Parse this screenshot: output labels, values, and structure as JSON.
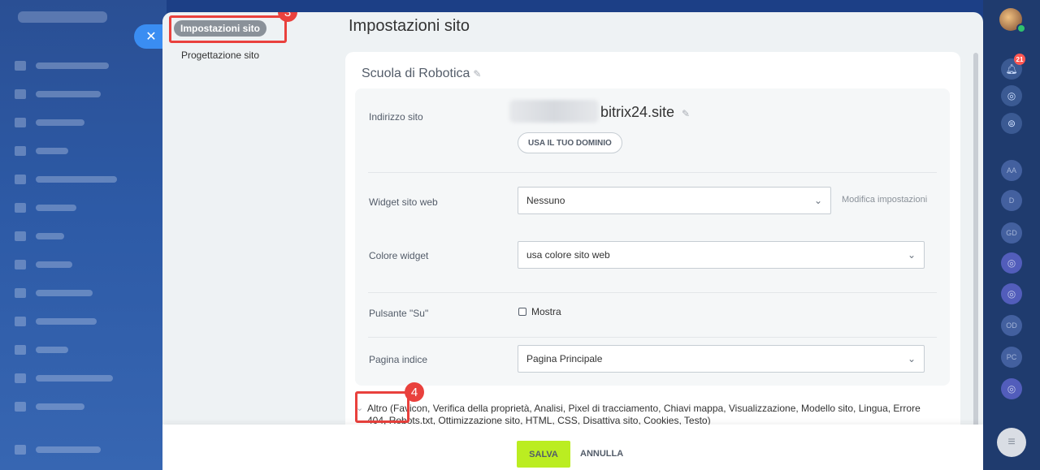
{
  "panel": {
    "title": "Impostazioni sito",
    "nav": [
      {
        "label": "Impostazioni sito",
        "active": true
      },
      {
        "label": "Progettazione sito",
        "active": false
      }
    ]
  },
  "card": {
    "site_name": "Scuola di Robotica",
    "address": {
      "label": "Indirizzo sito",
      "suffix": "bitrix24.site",
      "domain_button": "USA IL TUO DOMINIO"
    },
    "widget": {
      "label": "Widget sito web",
      "value": "Nessuno",
      "link": "Modifica impostazioni"
    },
    "widget_color": {
      "label": "Colore widget",
      "value": "usa colore sito web"
    },
    "up_button": {
      "label": "Pulsante \"Su\"",
      "checkbox_label": "Mostra"
    },
    "index_page": {
      "label": "Pagina indice",
      "value": "Pagina Principale"
    },
    "more": "Altro (Favicon, Verifica della proprietà, Analisi, Pixel di tracciamento, Chiavi mappa, Visualizzazione, Modello sito, Lingua, Errore 404, Robots.txt, Ottimizzazione sito, HTML, CSS, Disattiva sito, Cookies, Testo)"
  },
  "footer": {
    "save": "SALVA",
    "cancel": "ANNULLA"
  },
  "annotations": {
    "step_nav": "3",
    "step_more": "4"
  },
  "right_bar": {
    "notification_count": "21",
    "contacts": [
      "AA",
      "D",
      "GD",
      "OD",
      "PC"
    ]
  },
  "colors": {
    "highlight": "#e9413d",
    "save_green": "#bbed21",
    "close_blue": "#3a8df2"
  }
}
